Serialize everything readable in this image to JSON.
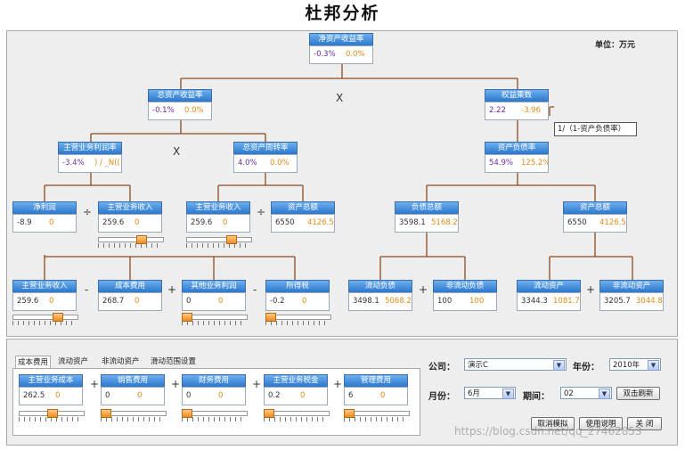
{
  "title": "杜邦分析",
  "unit": "单位：万元",
  "nodes": {
    "roe": {
      "label": "净资产收益率",
      "v1": "-0.3%",
      "v2": "0.0%"
    },
    "roa": {
      "label": "总资产收益率",
      "v1": "-0.1%",
      "v2": "0.0%"
    },
    "em": {
      "label": "权益乘数",
      "v1": "2.22",
      "v2": "-3.96"
    },
    "npm": {
      "label": "主营业务利润率",
      "v1": "-3.4%",
      "v2": ") / _N(("
    },
    "tat": {
      "label": "总资产周转率",
      "v1": "4.0%",
      "v2": "0.0%"
    },
    "dar": {
      "label": "资产负债率",
      "v1": "54.9%",
      "v2": "125.2%"
    },
    "np": {
      "label": "净利润",
      "v1": "-8.9",
      "v2": "0"
    },
    "rev1": {
      "label": "主营业务收入",
      "v1": "259.6",
      "v2": "0"
    },
    "rev2": {
      "label": "主营业务收入",
      "v1": "259.6",
      "v2": "0"
    },
    "ta1": {
      "label": "资产总额",
      "v1": "6550",
      "v2": "4126.5"
    },
    "tl": {
      "label": "负债总额",
      "v1": "3598.1",
      "v2": "5168.2"
    },
    "ta2": {
      "label": "资产总额",
      "v1": "6550",
      "v2": "4126.5"
    },
    "rev3": {
      "label": "主营业务收入",
      "v1": "259.6",
      "v2": "0"
    },
    "cost": {
      "label": "成本费用",
      "v1": "268.7",
      "v2": "0"
    },
    "other": {
      "label": "其他业务利润",
      "v1": "0",
      "v2": "0"
    },
    "tax": {
      "label": "所得税",
      "v1": "-0.2",
      "v2": "0"
    },
    "cl": {
      "label": "流动负债",
      "v1": "3498.1",
      "v2": "5068.2"
    },
    "ncl": {
      "label": "非流动负债",
      "v1": "100",
      "v2": "100"
    },
    "ca": {
      "label": "流动资产",
      "v1": "3344.3",
      "v2": "1081.7"
    },
    "nca": {
      "label": "非流动资产",
      "v1": "3205.7",
      "v2": "3044.8"
    },
    "c1": {
      "label": "主营业务成本",
      "v1": "262.5",
      "v2": "0"
    },
    "c2": {
      "label": "销售费用",
      "v1": "0",
      "v2": "0"
    },
    "c3": {
      "label": "财务费用",
      "v1": "0",
      "v2": "0"
    },
    "c4": {
      "label": "主营业务税金",
      "v1": "0.2",
      "v2": "0"
    },
    "c5": {
      "label": "管理费用",
      "v1": "6",
      "v2": "0"
    }
  },
  "ops": {
    "x": "X",
    "div": "÷",
    "plus": "+",
    "minus": "-"
  },
  "formula": "1/（1-资产负债率）",
  "tabs": [
    "成本费用",
    "流动资产",
    "非流动资产",
    "滑动范围设置"
  ],
  "controls": {
    "company_label": "公司：",
    "company_value": "演示C",
    "year_label": "年份：",
    "year_value": "2010年",
    "month_label": "月份：",
    "month_value": "6月",
    "period_label": "期间：",
    "period_value": "02",
    "refresh": "双击刷新",
    "cancel": "取消模拟",
    "help": "使用说明",
    "close": "关 闭"
  },
  "watermark": "https://blog.csdn.net/qq_27462853"
}
